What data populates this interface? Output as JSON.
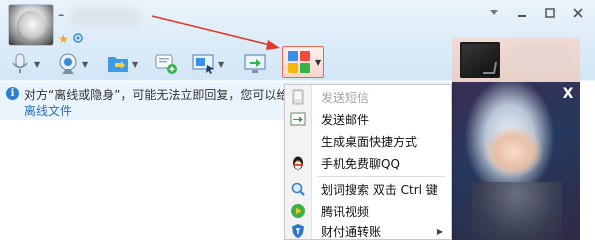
{
  "header": {
    "name_prefix": "-"
  },
  "icons": {
    "status": [
      "star-icon",
      "pin-icon"
    ],
    "window_controls": [
      "chevron-down-icon",
      "minimize-icon",
      "maximize-icon",
      "close-icon"
    ],
    "toolbar": [
      "microphone-icon",
      "webcam-icon",
      "folder-transfer-icon",
      "chat-add-icon",
      "screen-share-icon",
      "remote-assist-icon",
      "apps-grid-icon"
    ]
  },
  "notice": {
    "text": "对方“离线或隐身”，可能无法立即回复，您可以给",
    "link": "离线文件"
  },
  "menu": {
    "items": [
      {
        "label": "发送短信",
        "icon": "sms-icon",
        "disabled": true
      },
      {
        "label": "发送邮件",
        "icon": "mail-icon",
        "disabled": false
      },
      {
        "label": "生成桌面快捷方式",
        "icon": "",
        "disabled": false
      },
      {
        "label": "手机免费聊QQ",
        "icon": "qq-penguin-icon",
        "disabled": false
      },
      {
        "label": "划词搜索 双击 Ctrl 键",
        "icon": "magnifier-icon",
        "disabled": false
      },
      {
        "label": "腾讯视频",
        "icon": "play-icon",
        "disabled": false
      },
      {
        "label": "财付通转账",
        "icon": "shield-icon",
        "disabled": false
      }
    ]
  },
  "ad": {
    "close": "X"
  },
  "colors": {
    "accent_blue": "#2f7fd1",
    "highlight_border": "#e36b55",
    "notice_bg": "#e9f4fd",
    "link": "#2a6ebb"
  }
}
